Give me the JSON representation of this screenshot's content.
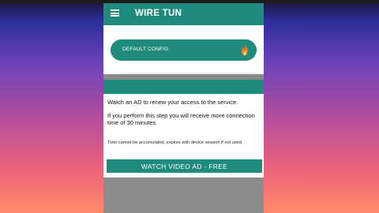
{
  "app": {
    "title": "WIRE TUN"
  },
  "config": {
    "label": "DEFAULT CONFIG",
    "icon": "flame-icon"
  },
  "dialog": {
    "line1": "Watch an AD to renew your access to the service.",
    "line2": "If you perform this step you will receive more connection time of 30 minutes",
    "note": "Time cannot be accumulated, expires with device session if not used.",
    "button_label": "WATCH VIDEO AD - FREE"
  },
  "colors": {
    "accent": "#1f8b7c",
    "flame": "#e8812a"
  }
}
